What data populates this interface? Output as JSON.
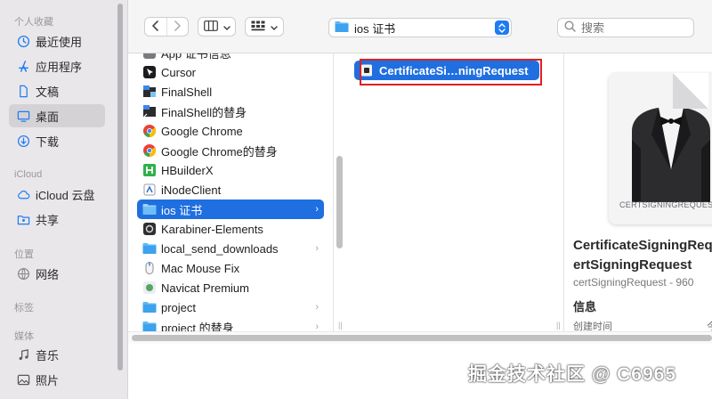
{
  "sidebar": {
    "favorites_label": "个人收藏",
    "favorites": [
      {
        "label": "最近使用",
        "icon": "clock-icon"
      },
      {
        "label": "应用程序",
        "icon": "apps-icon"
      },
      {
        "label": "文稿",
        "icon": "document-icon"
      },
      {
        "label": "桌面",
        "icon": "desktop-icon",
        "selected": true
      },
      {
        "label": "下载",
        "icon": "download-icon"
      }
    ],
    "icloud_label": "iCloud",
    "icloud": [
      {
        "label": "iCloud 云盘",
        "icon": "cloud-icon"
      },
      {
        "label": "共享",
        "icon": "shared-folder-icon"
      }
    ],
    "locations_label": "位置",
    "locations": [
      {
        "label": "网络",
        "icon": "network-icon"
      }
    ],
    "tags_label": "标签",
    "media_label": "媒体",
    "media": [
      {
        "label": "音乐",
        "icon": "music-icon"
      },
      {
        "label": "照片",
        "icon": "photos-icon"
      }
    ]
  },
  "toolbar": {
    "back_icon": "chevron-left-icon",
    "forward_icon": "chevron-right-icon",
    "path_title": "ios 证书",
    "search_placeholder": "搜索"
  },
  "column1": {
    "partial_top": "App 证书信息",
    "items": [
      {
        "label": "Cursor",
        "icon": "app-icon"
      },
      {
        "label": "FinalShell",
        "icon": "app-icon"
      },
      {
        "label": "FinalShell的替身",
        "icon": "alias-icon"
      },
      {
        "label": "Google Chrome",
        "icon": "chrome-icon"
      },
      {
        "label": "Google Chrome的替身",
        "icon": "chrome-icon"
      },
      {
        "label": "HBuilderX",
        "icon": "hbuilder-icon"
      },
      {
        "label": "iNodeClient",
        "icon": "app-icon"
      },
      {
        "label": "ios 证书",
        "icon": "folder-icon",
        "selected": true,
        "has_children": true
      },
      {
        "label": "Karabiner-Elements",
        "icon": "app-icon"
      },
      {
        "label": "local_send_downloads",
        "icon": "folder-icon",
        "has_children": true
      },
      {
        "label": "Mac Mouse Fix",
        "icon": "mouse-icon"
      },
      {
        "label": "Navicat Premium",
        "icon": "app-icon"
      },
      {
        "label": "project",
        "icon": "folder-icon",
        "has_children": true
      },
      {
        "label": "project 的替身",
        "icon": "folder-icon",
        "has_children": true
      }
    ]
  },
  "column2": {
    "file": "CertificateSi…ningRequest"
  },
  "preview": {
    "doc_label": "CERTSIGNINGREQUEST",
    "title_line1": "CertificateSigningReq",
    "title_line2": "ertSigningRequest",
    "subtitle": "certSigningRequest - 960",
    "info_label": "信息",
    "created_label": "创建时间",
    "created_value": "今"
  },
  "watermark": "掘金技术社区 @ C6965",
  "colors": {
    "accent": "#1f6fe0",
    "sidebar_bg": "#e9e7ea",
    "highlight_box": "#e02020"
  }
}
